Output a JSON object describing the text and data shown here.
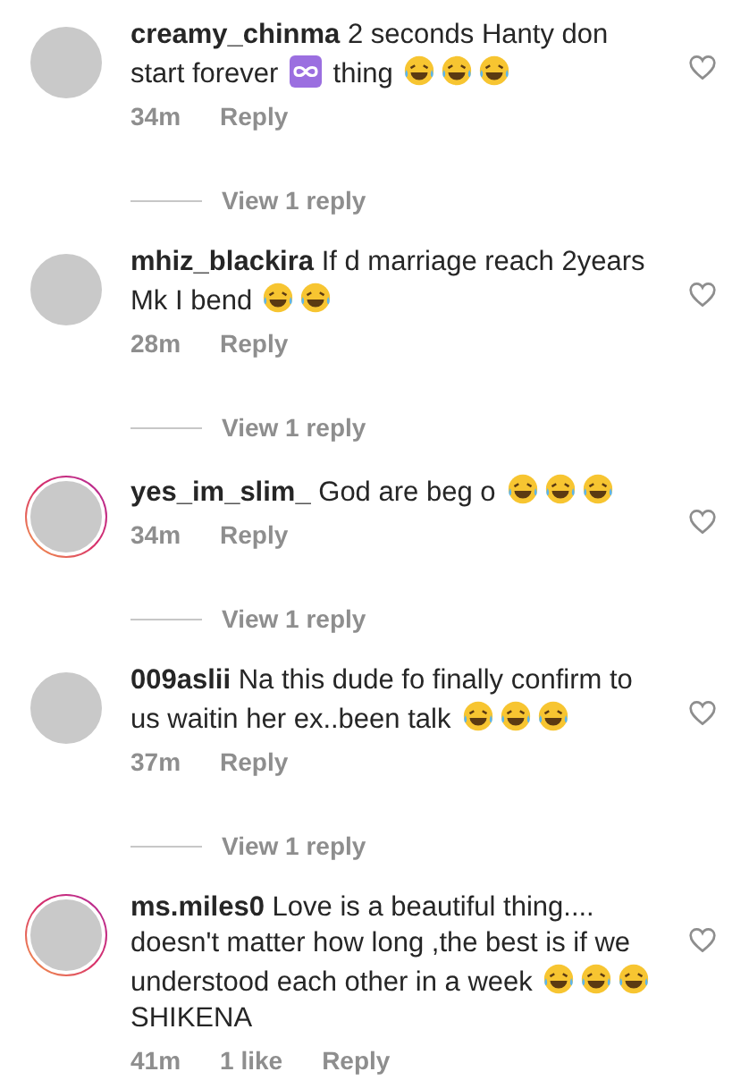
{
  "comments": [
    {
      "username": "creamy_chinma",
      "story_ring": false,
      "body": [
        {
          "kind": "text",
          "text": "2 seconds Hanty don start forever"
        },
        {
          "kind": "infinity"
        },
        {
          "kind": "text",
          "text": "thing"
        },
        {
          "kind": "laugh"
        },
        {
          "kind": "laugh"
        },
        {
          "kind": "laugh"
        }
      ],
      "time": "34m",
      "reply": "Reply",
      "view_replies": "View 1 reply"
    },
    {
      "username": "mhiz_blackira",
      "story_ring": false,
      "body": [
        {
          "kind": "text",
          "text": "If d marriage reach 2years Mk I bend"
        },
        {
          "kind": "laugh"
        },
        {
          "kind": "laugh"
        }
      ],
      "time": "28m",
      "reply": "Reply",
      "view_replies": "View 1 reply"
    },
    {
      "username": "yes_im_slim_",
      "story_ring": true,
      "body": [
        {
          "kind": "text",
          "text": "God are beg o"
        },
        {
          "kind": "laugh"
        },
        {
          "kind": "laugh"
        },
        {
          "kind": "laugh"
        }
      ],
      "time": "34m",
      "reply": "Reply",
      "view_replies": "View 1 reply"
    },
    {
      "username": "009aslii",
      "story_ring": false,
      "body": [
        {
          "kind": "text",
          "text": "Na this dude fo finally confirm to us waitin her ex..been talk"
        },
        {
          "kind": "laugh"
        },
        {
          "kind": "laugh"
        },
        {
          "kind": "laugh"
        }
      ],
      "time": "37m",
      "reply": "Reply",
      "view_replies": "View 1 reply"
    },
    {
      "username": "ms.miles0",
      "story_ring": true,
      "body": [
        {
          "kind": "text",
          "text": "Love is a beautiful thing.... doesn't matter how long ,the best is if we understood each other in a week"
        },
        {
          "kind": "laugh"
        },
        {
          "kind": "laugh"
        },
        {
          "kind": "laugh"
        },
        {
          "kind": "text",
          "text": "SHIKENA"
        }
      ],
      "time": "41m",
      "likes": "1 like",
      "reply": "Reply"
    }
  ]
}
